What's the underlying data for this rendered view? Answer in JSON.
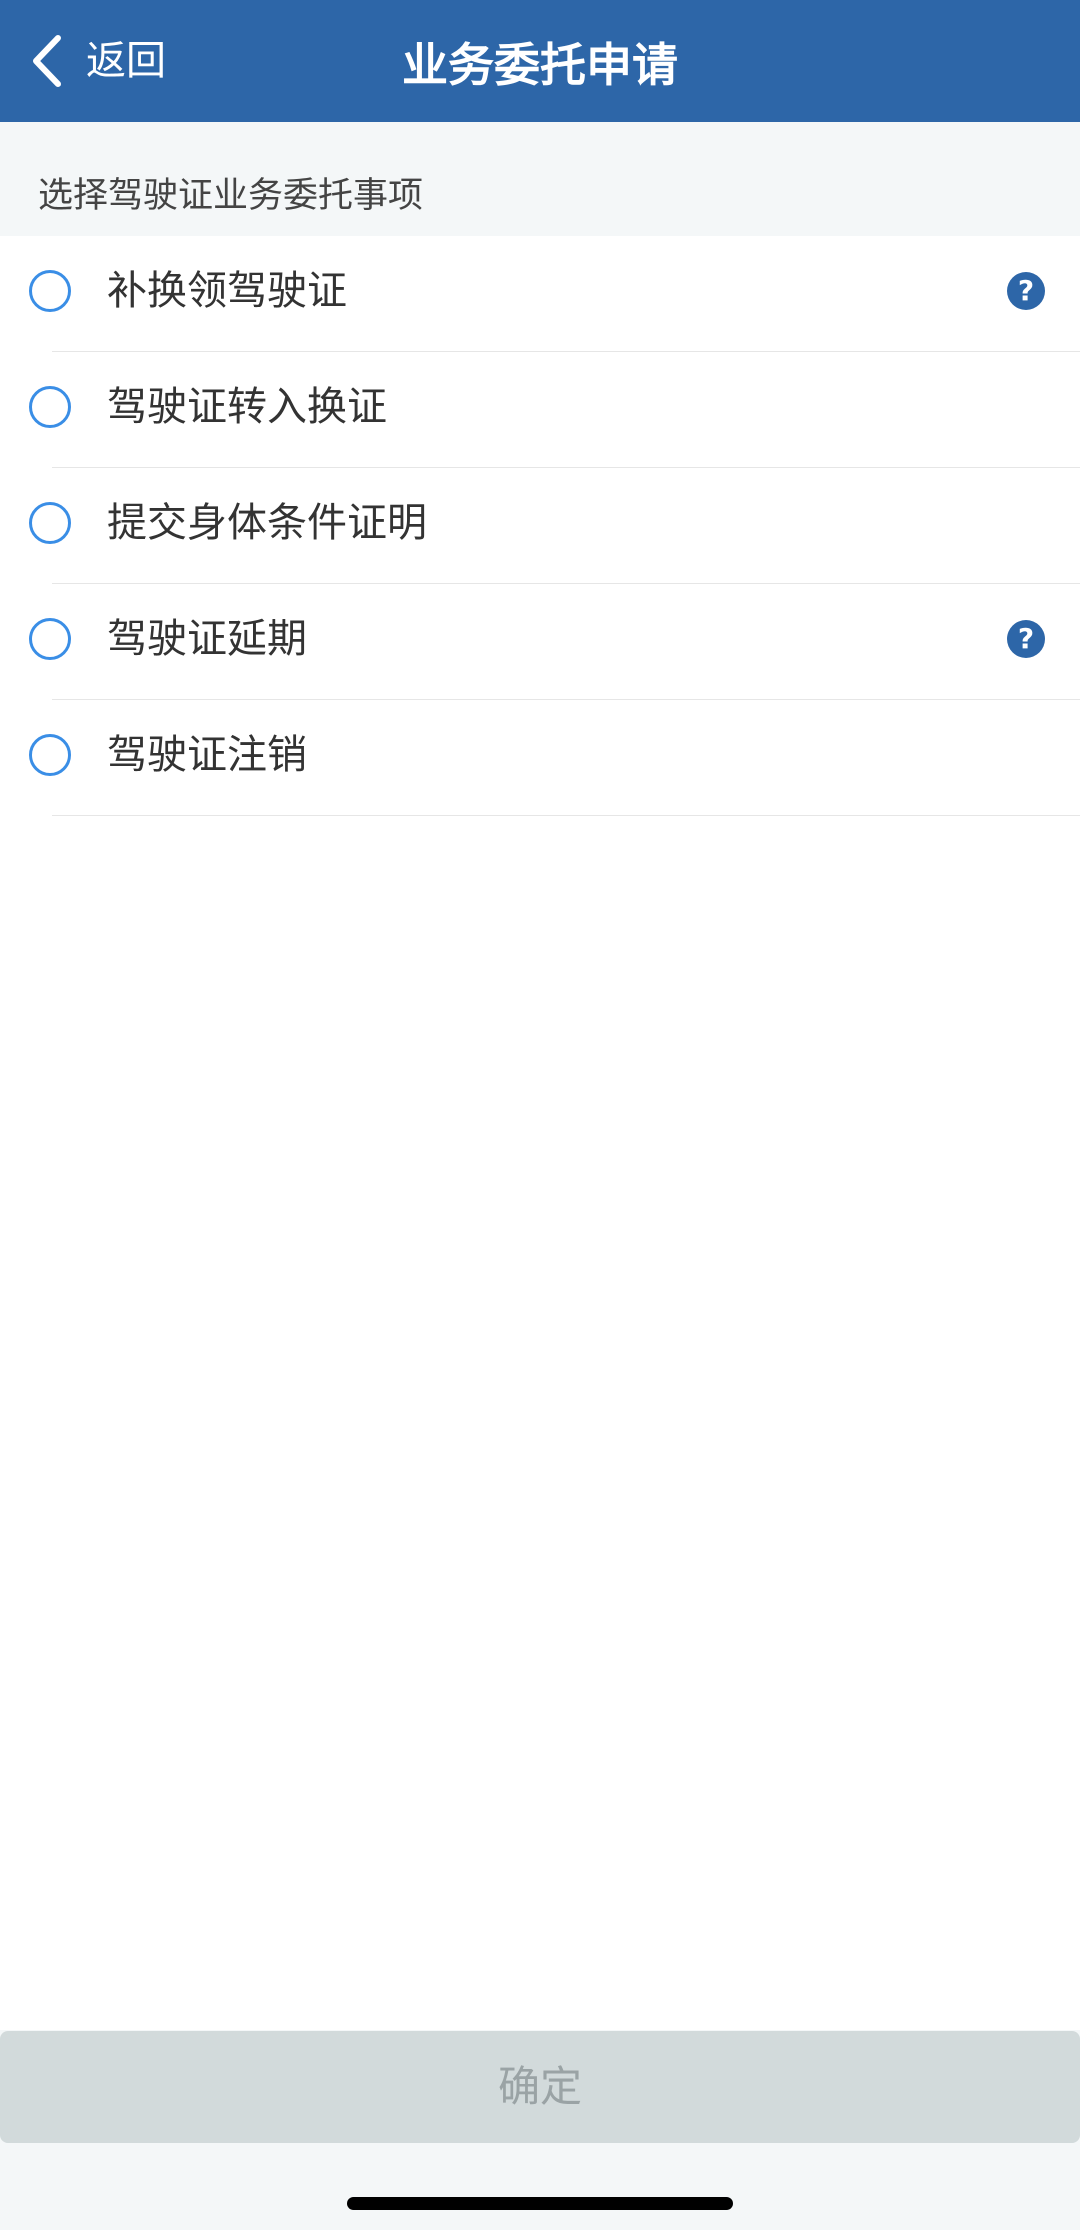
{
  "nav": {
    "back_label": "返回",
    "title": "业务委托申请"
  },
  "section": {
    "title": "选择驾驶证业务委托事项"
  },
  "options": [
    {
      "label": "补换领驾驶证",
      "has_help": true,
      "selected": false
    },
    {
      "label": "驾驶证转入换证",
      "has_help": false,
      "selected": false
    },
    {
      "label": "提交身体条件证明",
      "has_help": false,
      "selected": false
    },
    {
      "label": "驾驶证延期",
      "has_help": true,
      "selected": false
    },
    {
      "label": "驾驶证注销",
      "has_help": false,
      "selected": false
    }
  ],
  "help_icon_glyph": "?",
  "confirm_label": "确定",
  "colors": {
    "nav_bg": "#2d66a8",
    "radio_border": "#3a8ee6",
    "help_icon_bg": "#2d66a8",
    "confirm_bg": "#d2dadb",
    "confirm_text": "#9aa3a5"
  },
  "icons": {
    "back": "chevron-left-icon",
    "radio": "radio-unchecked-icon",
    "help": "question-circle-icon"
  }
}
